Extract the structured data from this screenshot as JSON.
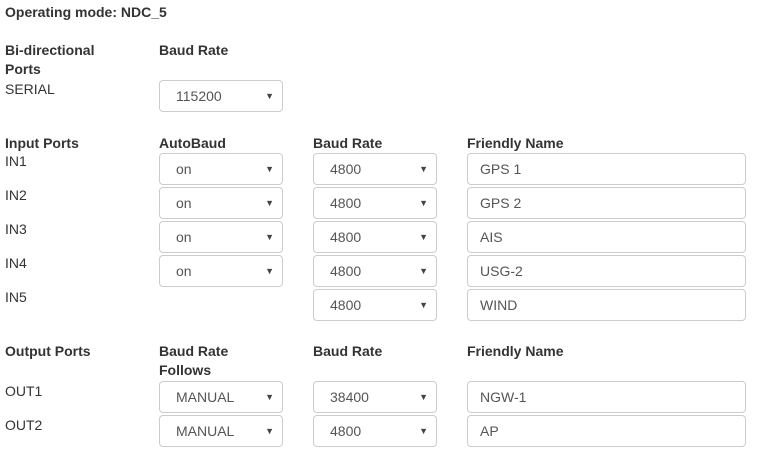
{
  "title": "Operating mode: NDC_5",
  "bidir": {
    "header": "Bi-directional Ports",
    "col_baud": "Baud Rate",
    "ports": [
      {
        "name": "SERIAL",
        "baud": "115200"
      }
    ]
  },
  "input": {
    "header": "Input Ports",
    "col_autobaud": "AutoBaud",
    "col_baud": "Baud Rate",
    "col_name": "Friendly Name",
    "ports": [
      {
        "name": "IN1",
        "autobaud": "on",
        "baud": "4800",
        "friendly": "GPS 1"
      },
      {
        "name": "IN2",
        "autobaud": "on",
        "baud": "4800",
        "friendly": "GPS 2"
      },
      {
        "name": "IN3",
        "autobaud": "on",
        "baud": "4800",
        "friendly": "AIS"
      },
      {
        "name": "IN4",
        "autobaud": "on",
        "baud": "4800",
        "friendly": "USG-2"
      },
      {
        "name": "IN5",
        "baud": "4800",
        "friendly": "WIND"
      }
    ]
  },
  "output": {
    "header": "Output Ports",
    "col_follows": "Baud Rate Follows",
    "col_baud": "Baud Rate",
    "col_name": "Friendly Name",
    "ports": [
      {
        "name": "OUT1",
        "follows": "MANUAL",
        "baud": "38400",
        "friendly": "NGW-1"
      },
      {
        "name": "OUT2",
        "follows": "MANUAL",
        "baud": "4800",
        "friendly": "AP"
      }
    ]
  },
  "arrow": "▼"
}
